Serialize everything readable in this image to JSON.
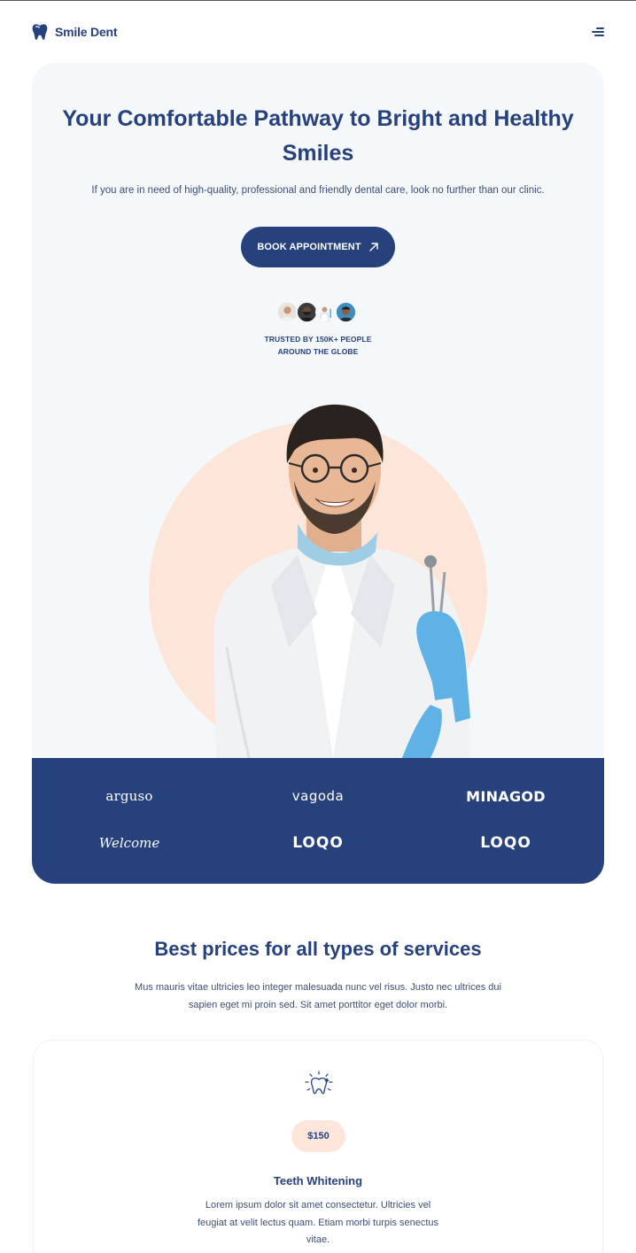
{
  "header": {
    "brand_name": "Smile Dent",
    "menu_icon": "hamburger-menu-icon",
    "logo_icon": "tooth-logo-icon"
  },
  "hero": {
    "title": "Your Comfortable Pathway to Bright and Healthy Smiles",
    "subtitle": "If you are in need of high-quality, professional and friendly dental care, look no further than our clinic.",
    "cta_label": "BOOK APPOINTMENT",
    "cta_icon": "arrow-up-right-icon",
    "trusted_line1": "TRUSTED BY 150K+ PEOPLE",
    "trusted_line2": "AROUND THE GLOBE"
  },
  "partner_logos": [
    "arguso",
    "vagoda",
    "MINAGOD",
    "Welcome",
    "LOQO",
    "LOQO"
  ],
  "services": {
    "title": "Best prices for all types of services",
    "subtitle": "Mus mauris vitae ultricies leo integer malesuada nunc vel risus. Justo nec ultrices dui sapien eget mi proin sed. Sit amet porttitor eget dolor morbi.",
    "cards": [
      {
        "icon": "sparkling-tooth-icon",
        "price": "$150",
        "title": "Teeth Whitening",
        "description": "Lorem ipsum dolor sit amet consectetur. Ultricies vel feugiat at velit lectus quam. Etiam morbi turpis senectus vitae."
      }
    ]
  },
  "colors": {
    "primary": "#26417c",
    "hero_bg": "#f4f8fb",
    "accent_peach": "#fde6d9",
    "white": "#ffffff"
  }
}
